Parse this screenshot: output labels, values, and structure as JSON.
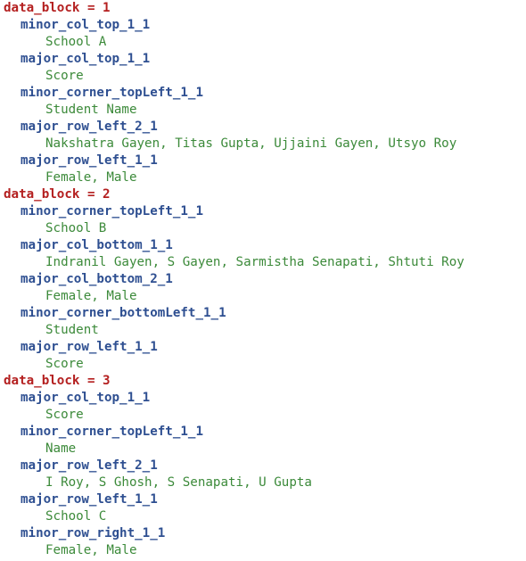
{
  "blocks": [
    {
      "label": "data_block = 1",
      "entries": [
        {
          "key": "minor_col_top_1_1",
          "value": "School A"
        },
        {
          "key": "major_col_top_1_1",
          "value": "Score"
        },
        {
          "key": "minor_corner_topLeft_1_1",
          "value": "Student Name"
        },
        {
          "key": "major_row_left_2_1",
          "value": "Nakshatra Gayen, Titas Gupta, Ujjaini Gayen, Utsyo Roy"
        },
        {
          "key": "major_row_left_1_1",
          "value": "Female, Male"
        }
      ]
    },
    {
      "label": "data_block = 2",
      "entries": [
        {
          "key": "minor_corner_topLeft_1_1",
          "value": "School B"
        },
        {
          "key": "major_col_bottom_1_1",
          "value": "Indranil Gayen, S Gayen, Sarmistha Senapati, Shtuti Roy"
        },
        {
          "key": "major_col_bottom_2_1",
          "value": "Female, Male"
        },
        {
          "key": "minor_corner_bottomLeft_1_1",
          "value": "Student"
        },
        {
          "key": "major_row_left_1_1",
          "value": "Score"
        }
      ]
    },
    {
      "label": "data_block = 3",
      "entries": [
        {
          "key": "major_col_top_1_1",
          "value": "Score"
        },
        {
          "key": "minor_corner_topLeft_1_1",
          "value": "Name"
        },
        {
          "key": "major_row_left_2_1",
          "value": "I Roy, S Ghosh, S Senapati, U Gupta"
        },
        {
          "key": "major_row_left_1_1",
          "value": "School C"
        },
        {
          "key": "minor_row_right_1_1",
          "value": "Female, Male"
        }
      ]
    }
  ]
}
